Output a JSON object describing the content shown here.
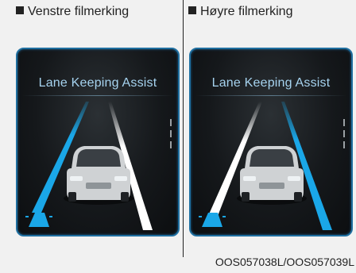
{
  "panels": [
    {
      "heading": "Venstre filmerking",
      "display_title": "Lane Keeping Assist",
      "highlighted_lane": "left"
    },
    {
      "heading": "Høyre filmerking",
      "display_title": "Lane Keeping Assist",
      "highlighted_lane": "right"
    }
  ],
  "caption": "OOS057038L/OOS057039L",
  "colors": {
    "highlight_lane": "#1aa7e8",
    "normal_lane": "#e6e6e6",
    "screen_border": "#1f6fa0",
    "title_text": "#a6d3ef"
  }
}
